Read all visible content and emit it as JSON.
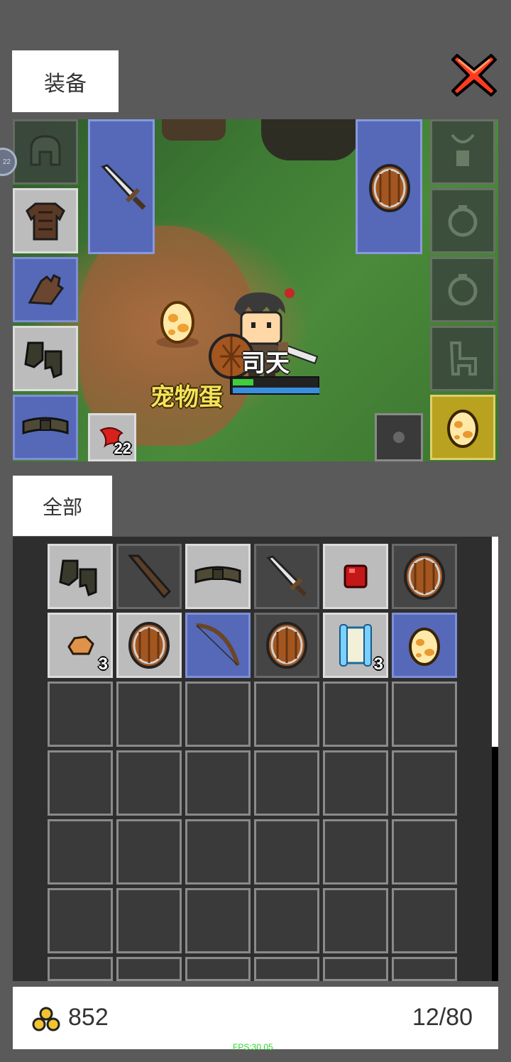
{
  "header": {
    "equip_tab": "装备"
  },
  "filter": {
    "all_tab": "全部"
  },
  "character": {
    "name": "司天",
    "hp_fraction": 0.5,
    "mp_fraction": 1.0
  },
  "scene": {
    "pet_label": "宠物蛋",
    "quick_item_count": "22",
    "side_badge": "22"
  },
  "left_equipment": [
    {
      "slot": "helmet",
      "icon": "helmet-icon",
      "style": "dim"
    },
    {
      "slot": "armor",
      "icon": "leather-armor-icon",
      "style": "light"
    },
    {
      "slot": "gloves",
      "icon": "leather-gloves-icon",
      "style": "blue"
    },
    {
      "slot": "boots",
      "icon": "boots-icon",
      "style": "light"
    },
    {
      "slot": "belt",
      "icon": "belt-icon",
      "style": "blue"
    }
  ],
  "right_equipment": [
    {
      "slot": "amulet",
      "icon": "amulet-icon",
      "style": "dim"
    },
    {
      "slot": "ring1",
      "icon": "ring-icon",
      "style": "dim"
    },
    {
      "slot": "ring2",
      "icon": "ring-icon",
      "style": "dim"
    },
    {
      "slot": "mount",
      "icon": "horse-icon",
      "style": "dim"
    },
    {
      "slot": "pet",
      "icon": "egg-icon",
      "style": "yellow"
    }
  ],
  "weapon_slot": {
    "icon": "sword-icon"
  },
  "offhand_slot": {
    "icon": "shield-icon"
  },
  "inventory": {
    "items": [
      {
        "icon": "boots-icon",
        "style": "light",
        "count": ""
      },
      {
        "icon": "club-icon",
        "style": "dark",
        "count": ""
      },
      {
        "icon": "belt-icon",
        "style": "light",
        "count": ""
      },
      {
        "icon": "sword-icon",
        "style": "dark",
        "count": ""
      },
      {
        "icon": "red-gem-icon",
        "style": "light",
        "count": ""
      },
      {
        "icon": "shield-icon",
        "style": "dark",
        "count": ""
      },
      {
        "icon": "ore-icon",
        "style": "light",
        "count": "3"
      },
      {
        "icon": "shield-icon",
        "style": "light",
        "count": ""
      },
      {
        "icon": "bow-icon",
        "style": "blue",
        "count": ""
      },
      {
        "icon": "shield-icon",
        "style": "dark",
        "count": ""
      },
      {
        "icon": "scroll-icon",
        "style": "light",
        "count": "3"
      },
      {
        "icon": "egg-icon",
        "style": "blue",
        "count": ""
      }
    ]
  },
  "footer": {
    "gold": "852",
    "capacity": "12/80",
    "fps": "FPS:30.05"
  },
  "colors": {
    "background": "#5a5a5a",
    "slot_blue": "#5668b8",
    "slot_yellow": "#b8a21f",
    "close_red": "#ff3b1f"
  }
}
